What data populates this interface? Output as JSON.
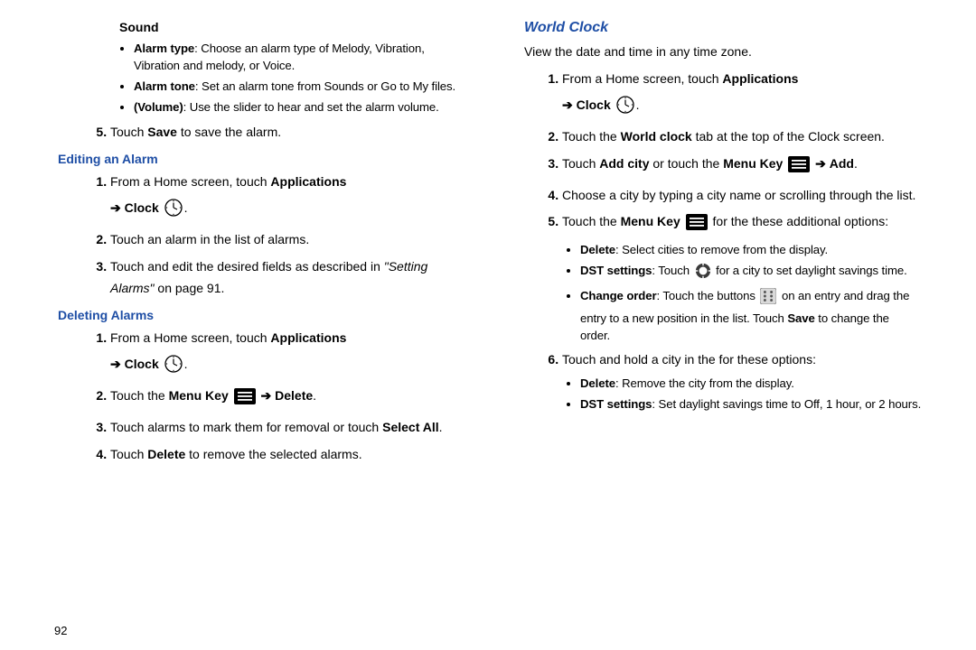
{
  "left": {
    "sound_heading": "Sound",
    "sound_bullets": {
      "a": {
        "label": "Alarm type",
        "text": ": Choose an alarm type of Melody, Vibration, Vibration and melody, or Voice."
      },
      "b": {
        "label": "Alarm tone",
        "text": ": Set an alarm tone from Sounds or Go to My files."
      },
      "c": {
        "label": "(Volume)",
        "text": ": Use the slider to hear and set the alarm volume."
      }
    },
    "save_line": {
      "pre": "Touch ",
      "bold": "Save",
      "post": " to save the alarm."
    },
    "editing_heading": "Editing an Alarm",
    "editing": {
      "s1": {
        "pre": "From a Home screen, touch ",
        "apps": "Applications",
        "clock": "Clock"
      },
      "s2": "Touch an alarm in the list of alarms.",
      "s3": {
        "pre": "Touch and edit the desired fields as described in ",
        "ital": "\"Setting Alarms\"",
        "post": " on page 91."
      }
    },
    "deleting_heading": "Deleting Alarms",
    "deleting": {
      "s1": {
        "pre": "From a Home screen, touch ",
        "apps": "Applications",
        "clock": "Clock"
      },
      "s2": {
        "pre": "Touch the ",
        "mk": "Menu Key",
        "arrow": " ➔ ",
        "del": "Delete"
      },
      "s3": {
        "pre": "Touch alarms to mark them for removal or touch ",
        "sa": "Select All"
      },
      "s4": {
        "pre": "Touch ",
        "del": "Delete",
        "post": " to remove the selected alarms."
      }
    }
  },
  "right": {
    "world_heading": "World Clock",
    "intro": "View the date and time in any time zone.",
    "s1": {
      "pre": "From a Home screen, touch ",
      "apps": "Applications",
      "clock": "Clock"
    },
    "s2": {
      "pre": "Touch the ",
      "wc": "World clock",
      "post": " tab at the top of the Clock screen."
    },
    "s3": {
      "pre": "Touch ",
      "ac": "Add city",
      "mid": " or touch the ",
      "mk": "Menu Key",
      "arrow": " ➔ ",
      "add": "Add"
    },
    "s4": "Choose a city by typing a city name or scrolling through the list.",
    "s5": {
      "pre": "Touch the ",
      "mk": "Menu Key",
      "post": " for the these additional options:"
    },
    "s5_bullets": {
      "a": {
        "label": "Delete",
        "text": ": Select cities to remove from the display."
      },
      "b": {
        "label": "DST settings",
        "mid": ": Touch ",
        "post": " for a city to set daylight savings time."
      },
      "c": {
        "label": "Change order",
        "mid": ": Touch the buttons ",
        "post1": " on an entry and drag the entry to a new position in the list. Touch ",
        "save": "Save",
        "post2": " to change the order."
      }
    },
    "s6": "Touch and hold a city in the for these options:",
    "s6_bullets": {
      "a": {
        "label": "Delete",
        "text": ": Remove the city from the display."
      },
      "b": {
        "label": "DST settings",
        "text": ": Set daylight savings time to Off, 1 hour, or 2 hours."
      }
    }
  },
  "page_number": "92",
  "arrow_glyph": "➔",
  "period": "."
}
